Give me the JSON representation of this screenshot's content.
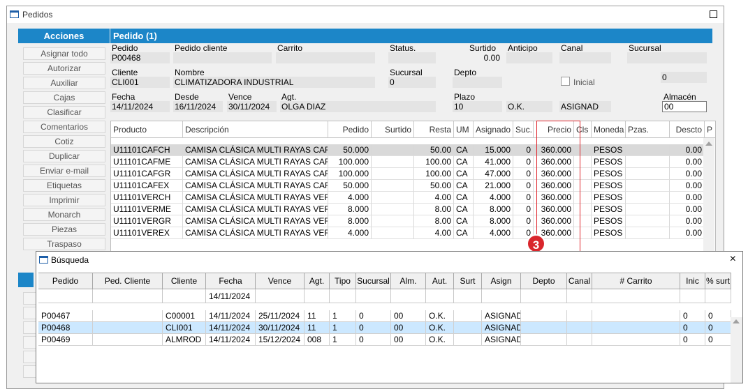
{
  "window": {
    "title": "Pedidos"
  },
  "acciones": {
    "header": "Acciones",
    "buttons": [
      "Asignar todo",
      "Autorizar",
      "Auxiliar",
      "Cajas",
      "Clasificar",
      "Comentarios",
      "Cotiz",
      "Duplicar",
      "Enviar e-mail",
      "Etiquetas",
      "Imprimir",
      "Monarch",
      "Piezas",
      "Traspaso"
    ]
  },
  "pedido": {
    "header": "Pedido (1)",
    "labels": {
      "pedido": "Pedido",
      "pedido_cliente": "Pedido cliente",
      "carrito": "Carrito",
      "status": "Status.",
      "surtido": "Surtido",
      "anticipo": "Anticipo",
      "canal": "Canal",
      "sucursal_top": "Sucursal",
      "cliente": "Cliente",
      "nombre": "Nombre",
      "sucursal": "Sucursal",
      "depto": "Depto",
      "inicial": "Inicial",
      "fecha": "Fecha",
      "desde": "Desde",
      "vence": "Vence",
      "agt": "Agt.",
      "plazo": "Plazo",
      "almacen": "Almacén"
    },
    "values": {
      "pedido": "P00468",
      "surtido": "0.00",
      "cliente": "CLI001",
      "nombre": "CLIMATIZADORA INDUSTRIAL",
      "sucursal": "0",
      "right_zero": "0",
      "fecha": "14/11/2024",
      "desde": "16/11/2024",
      "vence": "30/11/2024",
      "agt": "OLGA DIAZ",
      "plazo": "10",
      "ok": "O.K.",
      "asignad": "ASIGNAD",
      "almacen": "00"
    }
  },
  "items_grid": {
    "columns": [
      "Producto",
      "Descripción",
      "Pedido",
      "Surtido",
      "Resta",
      "UM",
      "Asignado",
      "Suc.",
      "Precio",
      "Cls",
      "Moneda",
      "Pzas.",
      "Descto",
      "P"
    ],
    "rows": [
      [
        "U11101CAFCH",
        "CAMISA CLÁSICA MULTI RAYAS CAF CI",
        "50.000",
        "",
        "50.00",
        "CA",
        "15.000",
        "0",
        "360.000",
        "",
        "PESOS",
        "",
        "0.00"
      ],
      [
        "U11101CAFME",
        "CAMISA CLÁSICA MULTI RAYAS CAF M",
        "100.000",
        "",
        "100.00",
        "CA",
        "41.000",
        "0",
        "360.000",
        "",
        "PESOS",
        "",
        "0.00"
      ],
      [
        "U11101CAFGR",
        "CAMISA CLÁSICA MULTI RAYAS CAF G",
        "100.000",
        "",
        "100.00",
        "CA",
        "47.000",
        "0",
        "360.000",
        "",
        "PESOS",
        "",
        "0.00"
      ],
      [
        "U11101CAFEX",
        "CAMISA CLÁSICA MULTI RAYAS CAF E)",
        "50.000",
        "",
        "50.00",
        "CA",
        "21.000",
        "0",
        "360.000",
        "",
        "PESOS",
        "",
        "0.00"
      ],
      [
        "U11101VERCH",
        "CAMISA CLÁSICA MULTI RAYAS VER CI",
        "4.000",
        "",
        "4.00",
        "CA",
        "4.000",
        "0",
        "360.000",
        "",
        "PESOS",
        "",
        "0.00"
      ],
      [
        "U11101VERME",
        "CAMISA CLÁSICA MULTI RAYAS VER M",
        "8.000",
        "",
        "8.00",
        "CA",
        "8.000",
        "0",
        "360.000",
        "",
        "PESOS",
        "",
        "0.00"
      ],
      [
        "U11101VERGR",
        "CAMISA CLÁSICA MULTI RAYAS VER G",
        "8.000",
        "",
        "8.00",
        "CA",
        "8.000",
        "0",
        "360.000",
        "",
        "PESOS",
        "",
        "0.00"
      ],
      [
        "U11101VEREX",
        "CAMISA CLÁSICA MULTI RAYAS VER E)",
        "4.000",
        "",
        "4.00",
        "CA",
        "4.000",
        "0",
        "360.000",
        "",
        "PESOS",
        "",
        "0.00"
      ]
    ],
    "callout": "3"
  },
  "busqueda": {
    "title": "Búsqueda",
    "close_icon": "×",
    "columns": [
      "Pedido",
      "Ped. Cliente",
      "Cliente",
      "Fecha",
      "Vence",
      "Agt.",
      "Tipo",
      "Sucursal",
      "Alm.",
      "Aut.",
      "Surt",
      "Asign",
      "Depto",
      "Canal",
      "# Carrito",
      "Inic",
      "% surt"
    ],
    "filter_fecha": "14/11/2024",
    "rows": [
      [
        "P00467",
        "",
        "C00001",
        "14/11/2024",
        "25/11/2024",
        "11",
        "1",
        "0",
        "00",
        "O.K.",
        "",
        "ASIGNAD",
        "",
        "",
        "",
        "0",
        "0"
      ],
      [
        "P00468",
        "",
        "CLI001",
        "14/11/2024",
        "30/11/2024",
        "11",
        "1",
        "0",
        "00",
        "O.K.",
        "",
        "ASIGNAD",
        "",
        "",
        "",
        "0",
        "0"
      ],
      [
        "P00469",
        "",
        "ALMROD",
        "14/11/2024",
        "15/12/2024",
        "008",
        "1",
        "0",
        "00",
        "O.K.",
        "",
        "ASIGNAD",
        "",
        "",
        "",
        "0",
        "0"
      ]
    ],
    "selected_row": 1
  },
  "colors": {
    "header_blue": "#1c86c8",
    "selected_row": "#cce8ff",
    "callout_red": "#d9262c"
  }
}
